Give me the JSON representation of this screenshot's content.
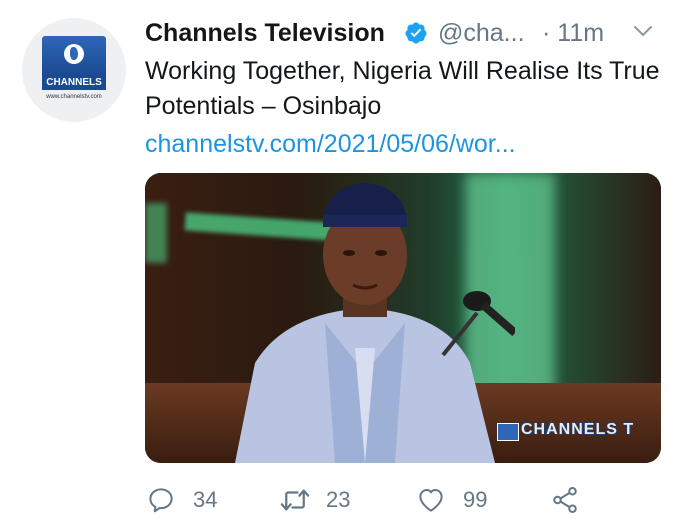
{
  "author": {
    "display_name": "Channels Television",
    "handle": "@cha...",
    "time_ago": "· 11m",
    "avatar_logo_text": "CHANNELS",
    "avatar_url_text": "www.channelstv.com",
    "verified": true
  },
  "tweet": {
    "text": "Working Together, Nigeria Will Realise Its True Potentials – Osinbajo",
    "link": "channelstv.com/2021/05/06/wor..."
  },
  "media": {
    "watermark_text": "CHANNELS T"
  },
  "actions": {
    "reply_count": "34",
    "retweet_count": "23",
    "like_count": "99"
  },
  "colors": {
    "link": "#1b95e0",
    "secondary_text": "#657786",
    "verified": "#1da1f2",
    "brand": "#2f66b8"
  },
  "icons": [
    "verified-badge-icon",
    "chevron-down-icon",
    "reply-icon",
    "retweet-icon",
    "like-icon",
    "share-icon"
  ]
}
